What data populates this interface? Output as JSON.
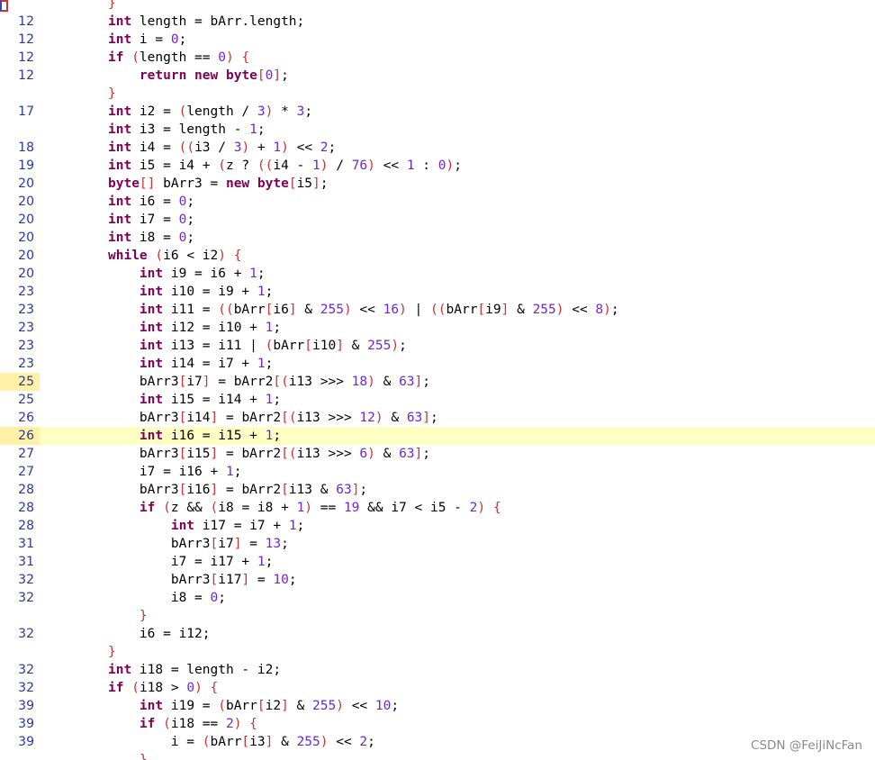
{
  "editor": {
    "highlight_color": "#ffffc4",
    "keyword_color": "#7f0055",
    "number_color": "#7025d5",
    "bracket_color": "#c83232",
    "line_number_color": "#2a3a9c",
    "lines": [
      {
        "ln": "",
        "code": "}"
      },
      {
        "ln": "12",
        "code": "int length = bArr.length;"
      },
      {
        "ln": "12",
        "code": "int i = 0;"
      },
      {
        "ln": "12",
        "code": "if (length == 0) {"
      },
      {
        "ln": "12",
        "code": "    return new byte[0];"
      },
      {
        "ln": "",
        "code": "}"
      },
      {
        "ln": "17",
        "code": "int i2 = (length / 3) * 3;"
      },
      {
        "ln": "",
        "code": "int i3 = length - 1;"
      },
      {
        "ln": "18",
        "code": "int i4 = ((i3 / 3) + 1) << 2;"
      },
      {
        "ln": "19",
        "code": "int i5 = i4 + (z ? ((i4 - 1) / 76) << 1 : 0);"
      },
      {
        "ln": "20",
        "code": "byte[] bArr3 = new byte[i5];"
      },
      {
        "ln": "20",
        "code": "int i6 = 0;"
      },
      {
        "ln": "20",
        "code": "int i7 = 0;"
      },
      {
        "ln": "20",
        "code": "int i8 = 0;"
      },
      {
        "ln": "20",
        "code": "while (i6 < i2) {"
      },
      {
        "ln": "20",
        "code": "    int i9 = i6 + 1;"
      },
      {
        "ln": "23",
        "code": "    int i10 = i9 + 1;"
      },
      {
        "ln": "23",
        "code": "    int i11 = ((bArr[i6] & 255) << 16) | ((bArr[i9] & 255) << 8);"
      },
      {
        "ln": "23",
        "code": "    int i12 = i10 + 1;"
      },
      {
        "ln": "23",
        "code": "    int i13 = i11 | (bArr[i10] & 255);"
      },
      {
        "ln": "23",
        "code": "    int i14 = i7 + 1;"
      },
      {
        "ln": "25",
        "code": "    bArr3[i7] = bArr2[(i13 >>> 18) & 63];",
        "hl": "gutter"
      },
      {
        "ln": "25",
        "code": "    int i15 = i14 + 1;"
      },
      {
        "ln": "26",
        "code": "    bArr3[i14] = bArr2[(i13 >>> 12) & 63];"
      },
      {
        "ln": "26",
        "code": "    int i16 = i15 + 1;",
        "hl": "full"
      },
      {
        "ln": "27",
        "code": "    bArr3[i15] = bArr2[(i13 >>> 6) & 63];"
      },
      {
        "ln": "27",
        "code": "    i7 = i16 + 1;"
      },
      {
        "ln": "28",
        "code": "    bArr3[i16] = bArr2[i13 & 63];"
      },
      {
        "ln": "28",
        "code": "    if (z && (i8 = i8 + 1) == 19 && i7 < i5 - 2) {"
      },
      {
        "ln": "28",
        "code": "        int i17 = i7 + 1;"
      },
      {
        "ln": "31",
        "code": "        bArr3[i7] = 13;"
      },
      {
        "ln": "31",
        "code": "        i7 = i17 + 1;"
      },
      {
        "ln": "32",
        "code": "        bArr3[i17] = 10;"
      },
      {
        "ln": "32",
        "code": "        i8 = 0;"
      },
      {
        "ln": "",
        "code": "    }"
      },
      {
        "ln": "32",
        "code": "    i6 = i12;"
      },
      {
        "ln": "",
        "code": "}"
      },
      {
        "ln": "32",
        "code": "int i18 = length - i2;"
      },
      {
        "ln": "32",
        "code": "if (i18 > 0) {"
      },
      {
        "ln": "39",
        "code": "    int i19 = (bArr[i2] & 255) << 10;"
      },
      {
        "ln": "39",
        "code": "    if (i18 == 2) {"
      },
      {
        "ln": "39",
        "code": "        i = (bArr[i3] & 255) << 2;"
      },
      {
        "ln": "",
        "code": "    }"
      }
    ]
  },
  "watermark": "CSDN @FeiJiNcFan"
}
